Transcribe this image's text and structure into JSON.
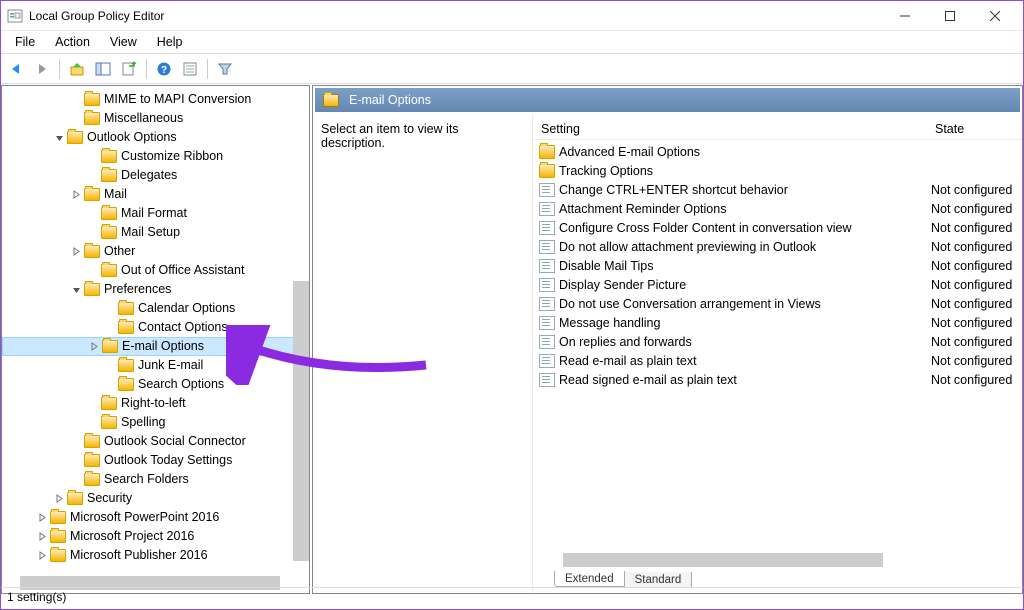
{
  "window": {
    "title": "Local Group Policy Editor"
  },
  "menubar": [
    "File",
    "Action",
    "View",
    "Help"
  ],
  "toolbar_icons": [
    "back-icon",
    "forward-icon",
    "up-icon",
    "show-hide-tree-icon",
    "export-list-icon",
    "help-icon",
    "properties-icon",
    "filter-icon"
  ],
  "tree": [
    {
      "level": 4,
      "exp": "none",
      "label": "MIME to MAPI Conversion"
    },
    {
      "level": 4,
      "exp": "none",
      "label": "Miscellaneous"
    },
    {
      "level": 3,
      "exp": "open",
      "label": "Outlook Options"
    },
    {
      "level": 5,
      "exp": "none",
      "label": "Customize Ribbon"
    },
    {
      "level": 5,
      "exp": "none",
      "label": "Delegates"
    },
    {
      "level": 4,
      "exp": "closed",
      "label": "Mail"
    },
    {
      "level": 5,
      "exp": "none",
      "label": "Mail Format"
    },
    {
      "level": 5,
      "exp": "none",
      "label": "Mail Setup"
    },
    {
      "level": 4,
      "exp": "closed",
      "label": "Other"
    },
    {
      "level": 5,
      "exp": "none",
      "label": "Out of Office Assistant"
    },
    {
      "level": 4,
      "exp": "open",
      "label": "Preferences"
    },
    {
      "level": 6,
      "exp": "none",
      "label": "Calendar Options"
    },
    {
      "level": 6,
      "exp": "none",
      "label": "Contact Options"
    },
    {
      "level": 5,
      "exp": "closed",
      "label": "E-mail Options",
      "selected": true
    },
    {
      "level": 6,
      "exp": "none",
      "label": "Junk E-mail"
    },
    {
      "level": 6,
      "exp": "none",
      "label": "Search Options"
    },
    {
      "level": 5,
      "exp": "none",
      "label": "Right-to-left"
    },
    {
      "level": 5,
      "exp": "none",
      "label": "Spelling"
    },
    {
      "level": 4,
      "exp": "none",
      "label": "Outlook Social Connector"
    },
    {
      "level": 4,
      "exp": "none",
      "label": "Outlook Today Settings"
    },
    {
      "level": 4,
      "exp": "none",
      "label": "Search Folders"
    },
    {
      "level": 3,
      "exp": "closed",
      "label": "Security"
    },
    {
      "level": 2,
      "exp": "closed",
      "label": "Microsoft PowerPoint 2016"
    },
    {
      "level": 2,
      "exp": "closed",
      "label": "Microsoft Project 2016"
    },
    {
      "level": 2,
      "exp": "closed",
      "label": "Microsoft Publisher 2016"
    }
  ],
  "details": {
    "header": "E-mail Options",
    "description_hint": "Select an item to view its description.",
    "columns": {
      "setting": "Setting",
      "state": "State"
    },
    "rows": [
      {
        "type": "folder",
        "name": "Advanced E-mail Options",
        "state": ""
      },
      {
        "type": "folder",
        "name": "Tracking Options",
        "state": ""
      },
      {
        "type": "setting",
        "name": "Change CTRL+ENTER shortcut behavior",
        "state": "Not configured"
      },
      {
        "type": "setting",
        "name": "Attachment Reminder Options",
        "state": "Not configured"
      },
      {
        "type": "setting",
        "name": "Configure Cross Folder Content in conversation view",
        "state": "Not configured"
      },
      {
        "type": "setting",
        "name": "Do not allow attachment previewing in Outlook",
        "state": "Not configured"
      },
      {
        "type": "setting",
        "name": "Disable Mail Tips",
        "state": "Not configured"
      },
      {
        "type": "setting",
        "name": "Display Sender Picture",
        "state": "Not configured"
      },
      {
        "type": "setting",
        "name": "Do not use Conversation arrangement in Views",
        "state": "Not configured"
      },
      {
        "type": "setting",
        "name": "Message handling",
        "state": "Not configured"
      },
      {
        "type": "setting",
        "name": "On replies and forwards",
        "state": "Not configured"
      },
      {
        "type": "setting",
        "name": "Read e-mail as plain text",
        "state": "Not configured"
      },
      {
        "type": "setting",
        "name": "Read signed e-mail as plain text",
        "state": "Not configured"
      }
    ],
    "tabs": {
      "extended": "Extended",
      "standard": "Standard"
    }
  },
  "statusbar": "1 setting(s)"
}
